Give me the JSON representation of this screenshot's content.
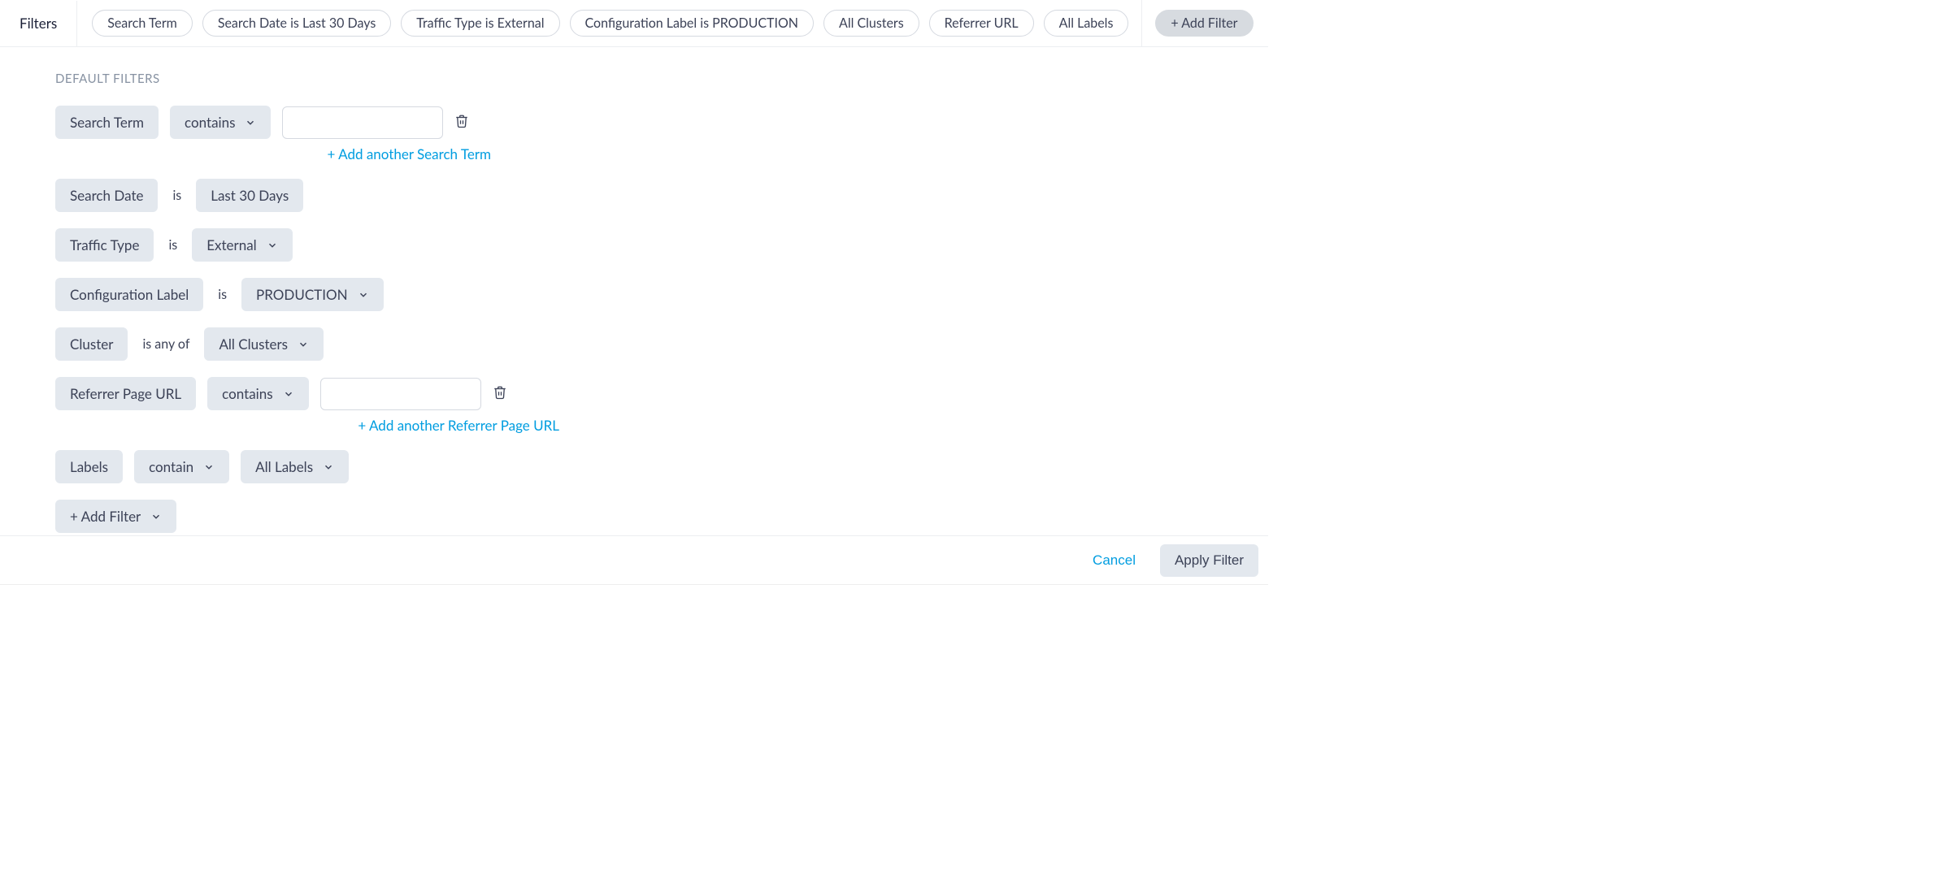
{
  "topbar": {
    "title": "Filters",
    "pills": [
      "Search Term",
      "Search Date is Last 30 Days",
      "Traffic Type is External",
      "Configuration Label is PRODUCTION",
      "All Clusters",
      "Referrer URL",
      "All Labels"
    ],
    "add_label": "+ Add Filter"
  },
  "section_title": "DEFAULT FILTERS",
  "rows": {
    "search_term": {
      "field": "Search Term",
      "op": "contains",
      "value": "",
      "add_another": "+ Add another Search Term"
    },
    "search_date": {
      "field": "Search Date",
      "op": "is",
      "value": "Last 30 Days"
    },
    "traffic_type": {
      "field": "Traffic Type",
      "op": "is",
      "value": "External"
    },
    "config_label": {
      "field": "Configuration Label",
      "op": "is",
      "value": "PRODUCTION"
    },
    "cluster": {
      "field": "Cluster",
      "op": "is any of",
      "value": "All Clusters"
    },
    "referrer": {
      "field": "Referrer Page URL",
      "op": "contains",
      "value": "",
      "add_another": "+ Add another Referrer Page URL"
    },
    "labels": {
      "field": "Labels",
      "op": "contain",
      "value": "All Labels"
    }
  },
  "add_filter_button": "+ Add Filter",
  "footer": {
    "cancel": "Cancel",
    "apply": "Apply Filter"
  }
}
